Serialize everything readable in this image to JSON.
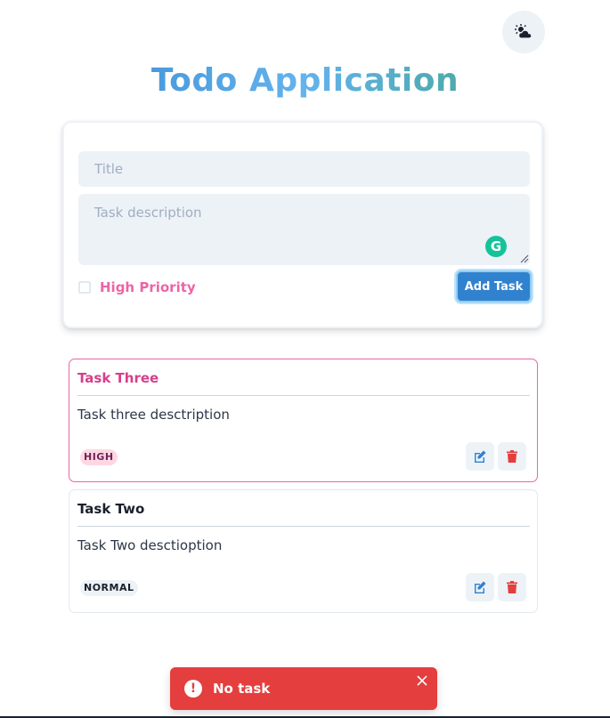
{
  "header": {
    "title_word1": "Todo",
    "title_word2": "Application",
    "theme_toggle_icon": "cloud-sun-icon"
  },
  "form": {
    "title_placeholder": "Title",
    "description_placeholder": "Task description",
    "priority_label": "High Priority",
    "priority_checked": false,
    "add_button_label": "Add Task",
    "grammarly_icon": "G"
  },
  "tasks": [
    {
      "title": "Task Three",
      "description": "Task three desctription",
      "priority": "HIGH",
      "edit_icon": "edit-icon",
      "delete_icon": "trash-icon"
    },
    {
      "title": "Task Two",
      "description": "Task Two desctioption",
      "priority": "NORMAL",
      "edit_icon": "edit-icon",
      "delete_icon": "trash-icon"
    }
  ],
  "toast": {
    "message": "No task",
    "icon": "alert-circle-icon",
    "close_icon": "close-icon"
  },
  "colors": {
    "accent": "#3182ce",
    "high_priority": "#d53f8c",
    "danger": "#e53e3e",
    "grammarly": "#15c39a"
  }
}
